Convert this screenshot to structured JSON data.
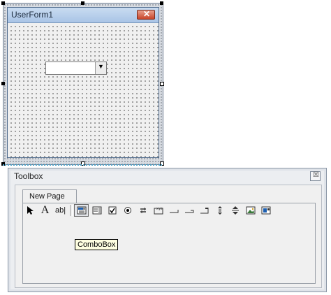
{
  "userform": {
    "title": "UserForm1",
    "close_label": "✕"
  },
  "toolbox": {
    "title": "Toolbox",
    "close_label": "☒",
    "tab_label": "New Page",
    "tools": [
      {
        "name": "select-objects-icon",
        "glyph": "➤"
      },
      {
        "name": "label-icon",
        "glyph": "A"
      },
      {
        "name": "textbox-icon",
        "glyph": "ab|"
      },
      {
        "name": "combobox-icon",
        "glyph": ""
      },
      {
        "name": "listbox-icon",
        "glyph": ""
      },
      {
        "name": "checkbox-icon",
        "glyph": ""
      },
      {
        "name": "optionbutton-icon",
        "glyph": ""
      },
      {
        "name": "togglebutton-icon",
        "glyph": ""
      },
      {
        "name": "frame-icon",
        "glyph": ""
      },
      {
        "name": "commandbutton-icon",
        "glyph": ""
      },
      {
        "name": "tabstrip-icon",
        "glyph": ""
      },
      {
        "name": "multipage-icon",
        "glyph": ""
      },
      {
        "name": "scrollbar-icon",
        "glyph": ""
      },
      {
        "name": "spinbutton-icon",
        "glyph": ""
      },
      {
        "name": "image-icon",
        "glyph": ""
      },
      {
        "name": "refedit-icon",
        "glyph": ""
      }
    ],
    "tooltip": "ComboBox"
  }
}
